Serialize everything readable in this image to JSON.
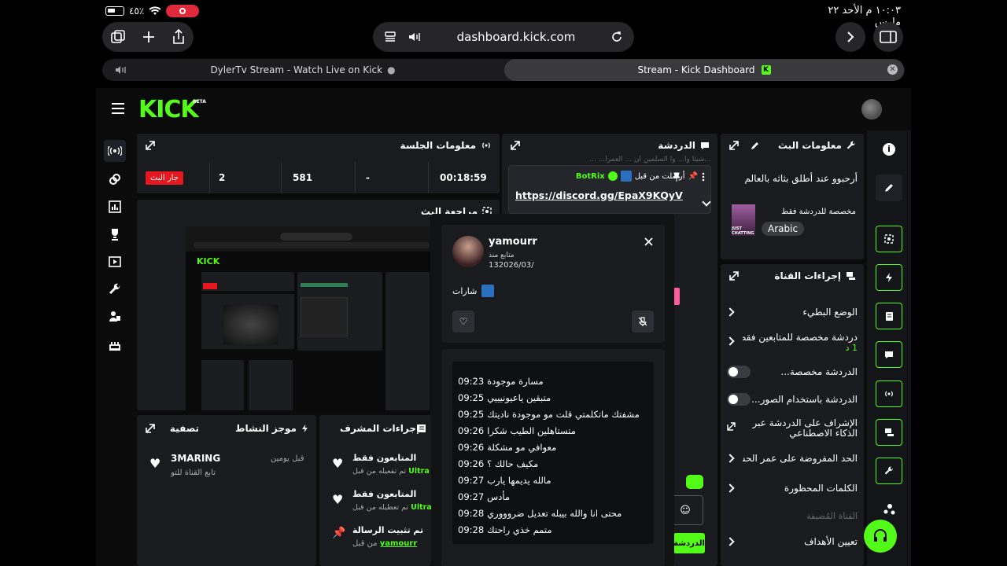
{
  "status_bar": {
    "time_date": "١٠:٠٣ م  الأحد ٢٢ مارس",
    "battery": "٤٥٪"
  },
  "browser": {
    "url": "dashboard.kick.com",
    "tabs": [
      {
        "label": "DylerTv Stream - Watch Live on Kick"
      },
      {
        "label": "Stream - Kick Dashboard"
      }
    ]
  },
  "header": {
    "logo": "KICK",
    "logo_badge": "BETA"
  },
  "session_info": {
    "title": "معلومات الجلسة",
    "live_badge": "جار البث",
    "followers": "2",
    "viewers": "581",
    "subs": "-",
    "duration": "00:18:59"
  },
  "stream_preview": {
    "title": "مراجعة البث"
  },
  "chat": {
    "title": "الدردشة",
    "top_text": "...شيئاً وأ... وأ السلمين أن  ... العمرا... ...",
    "pinned": {
      "pinned_by": "أرسلت من قبل",
      "user": "BotRix",
      "link": "https://discord.gg/EpaX9KQyV"
    },
    "send_label": "الدردشة"
  },
  "stream_info": {
    "title": "معلومات البث",
    "stream_title": "أرحبوو عند أطلق بثاثه بالعالم",
    "category": "مخصصة للدردشة فقط",
    "language": "Arabic",
    "thumb_text": "JUST CHATTING"
  },
  "channel_actions": {
    "title": "إجراءات القناة",
    "items": [
      {
        "label": "الوضع البطيء",
        "type": "chevron"
      },
      {
        "label": "دردشة مخصصة للمتابعين فقط",
        "sub": "1 د",
        "type": "chevron"
      },
      {
        "label": "الدردشة مخصصة...",
        "type": "toggle"
      },
      {
        "label": "الدردشة باستخدام الصور...",
        "type": "toggle"
      },
      {
        "label": "الإشراف على الدردشة عبر الذكاء الاصطناعي",
        "type": "link"
      },
      {
        "label": "الحد المفروضة على عمر الحساب",
        "type": "chevron"
      },
      {
        "label": "الكلمات المحظورة",
        "type": "chevron"
      },
      {
        "label": "القناة المُضيفة",
        "type": "muted"
      },
      {
        "label": "تعيين الأهداف",
        "type": "chevron"
      }
    ]
  },
  "activity": {
    "title": "موجز النشاط",
    "filter": "تصفية",
    "item_user": "3MARING",
    "item_time": "قبل يومين",
    "item_text": "تابع القناة للتو"
  },
  "mod_actions": {
    "title": "إجراءات المشرف",
    "items": [
      {
        "title": "المتابعون فقط",
        "by": "تم تفعيله من قبل",
        "user": "Ultra"
      },
      {
        "title": "المتابعون فقط",
        "by": "تم تعطيله من قبل",
        "user": "Ultra"
      },
      {
        "title": "تم تثبيت الرسالة",
        "by": "من قبل",
        "user": "yamourr"
      }
    ]
  },
  "user_card": {
    "username": "yamourr",
    "follow_label": "متابع منذ",
    "follow_date": "132026/03/",
    "badges_label": "شارات",
    "messages": [
      {
        "time": "09:23",
        "text": "مسارة موجودة"
      },
      {
        "time": "09:25",
        "text": "متبقين ياعيونيييي"
      },
      {
        "time": "09:25",
        "text": "مشفتك ماتكلمتي قلت مو موجودة ناديتك"
      },
      {
        "time": "09:26",
        "text": "متستاهلين الطيب شكرا"
      },
      {
        "time": "09:26",
        "text": "معوافي مو مشكلة"
      },
      {
        "time": "09:26",
        "text": "مكيف حالك ؟"
      },
      {
        "time": "09:27",
        "text": "مالله يديمها يارب"
      },
      {
        "time": "09:27",
        "text": "مأدس"
      },
      {
        "time": "09:28",
        "text": "محتى انا والله بيبله تعديل ضروووري"
      },
      {
        "time": "09:28",
        "text": "متمم خذي راحتك"
      }
    ]
  },
  "colors": {
    "accent": "#53fc18",
    "panel": "#191b1f",
    "bg": "#0b0b0c",
    "live": "#e5171f"
  }
}
